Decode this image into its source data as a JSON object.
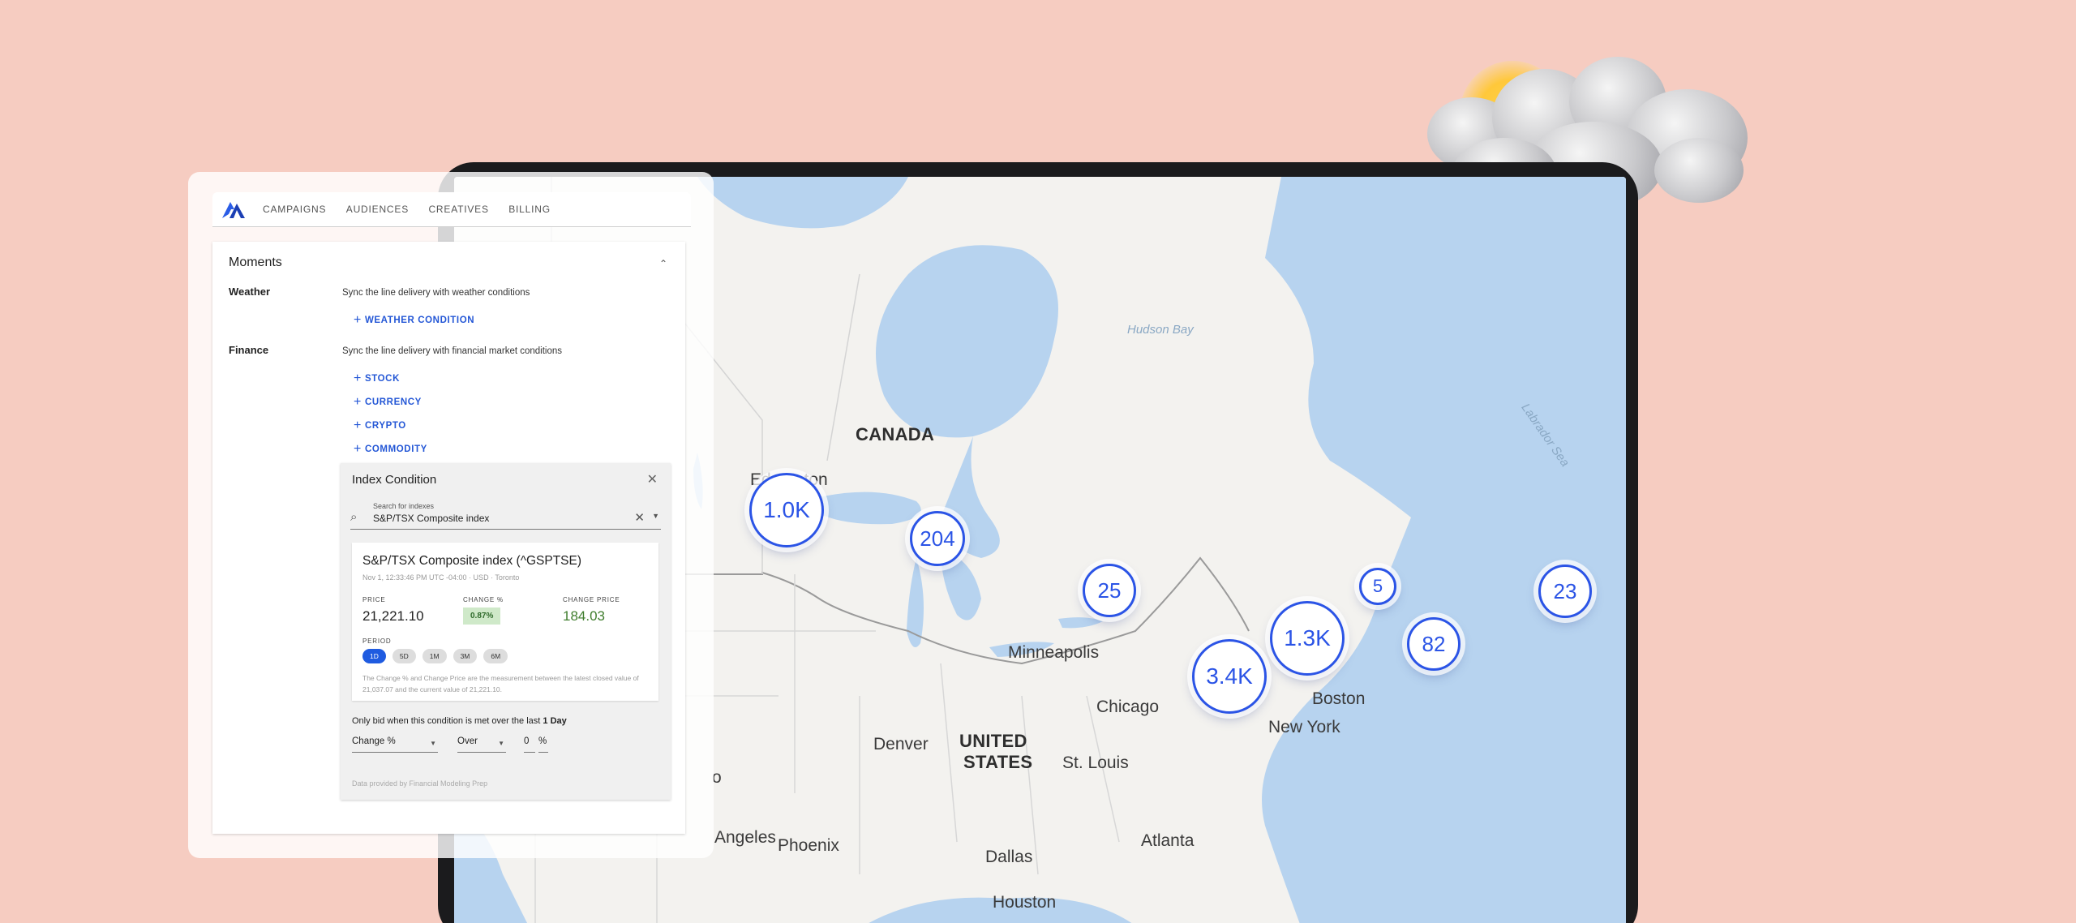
{
  "nav": {
    "logo": "logo-icon",
    "items": [
      "CAMPAIGNS",
      "AUDIENCES",
      "CREATIVES",
      "BILLING"
    ]
  },
  "moments": {
    "title": "Moments",
    "weather": {
      "label": "Weather",
      "description": "Sync the line delivery with weather conditions",
      "add_label": "WEATHER CONDITION"
    },
    "finance": {
      "label": "Finance",
      "description": "Sync the line delivery with financial market conditions",
      "options": [
        "STOCK",
        "CURRENCY",
        "CRYPTO",
        "COMMODITY"
      ]
    }
  },
  "index_condition": {
    "title": "Index Condition",
    "search": {
      "label": "Search for indexes",
      "value": "S&P/TSX Composite index"
    },
    "stock": {
      "name": "S&P/TSX Composite index (^GSPTSE)",
      "meta": "Nov 1, 12:33:46 PM UTC -04:00 · USD · Toronto",
      "price_label": "PRICE",
      "price": "21,221.10",
      "change_pct_label": "CHANGE %",
      "change_pct": "0.87%",
      "change_price_label": "CHANGE PRICE",
      "change_price": "184.03",
      "period_label": "PERIOD",
      "periods": [
        "1D",
        "5D",
        "1M",
        "3M",
        "6M"
      ],
      "active_period": "1D",
      "note": "The Change % and Change Price are the measurement between the latest closed value of 21,037.07 and the current value of 21,221.10."
    },
    "bid_text": "Only bid when this condition is met over the last",
    "bid_period": "1 Day",
    "metric": "Change %",
    "operator": "Over",
    "threshold": "0",
    "unit": "%",
    "attribution": "Data provided by Financial Modeling Prep"
  },
  "map": {
    "labels": {
      "canada": "CANADA",
      "united": "UNITED",
      "states": "STATES",
      "edmonton": "Edmonton",
      "minneapolis": "Minneapolis",
      "chicago": "Chicago",
      "denver": "Denver",
      "st_louis": "St. Louis",
      "boston": "Boston",
      "new_york": "New York",
      "atlanta": "Atlanta",
      "dallas": "Dallas",
      "houston": "Houston",
      "phoenix": "Phoenix",
      "los_angeles": "Angeles",
      "sf": "o",
      "hudson_bay": "Hudson Bay",
      "labrador_sea": "Labrador Sea"
    },
    "clusters": [
      "1.0K",
      "204",
      "25",
      "5",
      "1.3K",
      "3.4K",
      "82",
      "23"
    ]
  },
  "colors": {
    "accent": "#2457d6",
    "cluster": "#2b54e6",
    "background": "#f6ccc1"
  }
}
